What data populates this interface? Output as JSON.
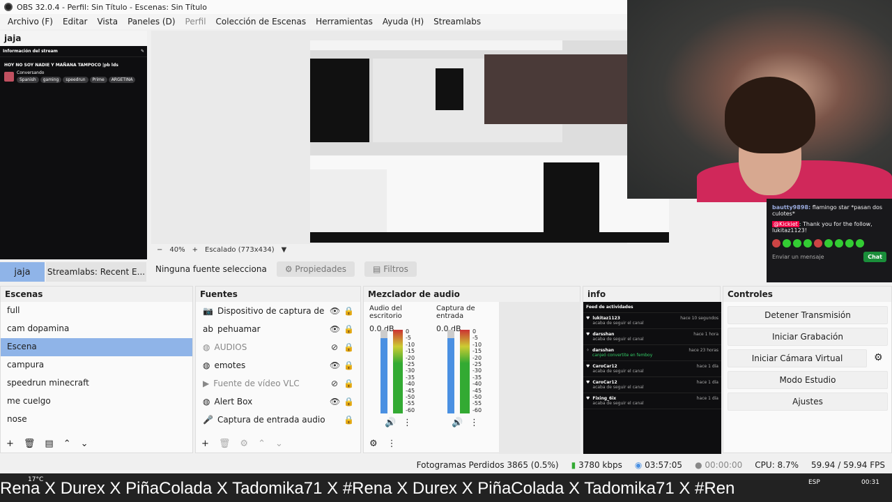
{
  "window": {
    "title": "OBS 32.0.4 - Perfil: Sin Título - Escenas: Sin Título"
  },
  "menu": [
    "Archivo (F)",
    "Editar",
    "Vista",
    "Paneles (D)",
    "Perfil",
    "Colección de Escenas",
    "Herramientas",
    "Ayuda (H)",
    "Streamlabs"
  ],
  "dock": {
    "title": "jaja",
    "stream_info": {
      "header": "Información del stream",
      "title": "HOY NO SOY NADIE Y MAÑANA TAMPOCO |pb lds",
      "category": "Conversando",
      "tags": [
        "Spanish",
        "gaming",
        "speedrun",
        "Prime",
        "ARGETINA"
      ]
    }
  },
  "preview": {
    "zoom": "40%",
    "scaling": "Escalado (773x434)"
  },
  "chat": {
    "msg1_user": "bautty9898:",
    "msg1_text": "flamingo star *pasan dos culotes*",
    "msg2_user": "@Kickiet",
    "msg2_text": ": Thank you for the follow, lukitaz1123!",
    "input": "Enviar un mensaje",
    "button": "Chat"
  },
  "tabs": {
    "jaja": "jaja",
    "recent": "Streamlabs: Recent E..."
  },
  "source_toolbar": {
    "none": "Ninguna fuente selecciona",
    "props": "Propiedades",
    "filters": "Filtros"
  },
  "scenes": {
    "title": "Escenas",
    "items": [
      "full",
      "cam dopamina",
      "Escena",
      "campura",
      "speedrun minecraft",
      "me cuelgo",
      "nose"
    ]
  },
  "sources": {
    "title": "Fuentes",
    "items": [
      "Dispositivo de captura de víd",
      "pehuamar",
      "AUDIOS",
      "emotes",
      "Fuente de vídeo VLC",
      "Alert Box",
      "Captura de entrada audio"
    ]
  },
  "mixer": {
    "title": "Mezclador de audio",
    "channels": [
      {
        "name": "Audio del escritorio",
        "db": "0.0 dB"
      },
      {
        "name": "Captura de entrada",
        "db": "0.0 dB"
      }
    ],
    "scale": [
      "0",
      "-5",
      "-10",
      "-15",
      "-20",
      "-25",
      "-30",
      "-35",
      "-40",
      "-45",
      "-50",
      "-55",
      "-60"
    ]
  },
  "info": {
    "title": "info",
    "feed_header": "Feed de actividades",
    "items": [
      {
        "user": "lukitaz1123",
        "action": "acaba de seguir el canal",
        "time": "hace 10 segundos"
      },
      {
        "user": "darsshan",
        "action": "acaba de seguir el canal",
        "time": "hace 1 hora"
      },
      {
        "user": "darsshan",
        "action": "canjeó convertite en femboy",
        "time": "hace 23 horas"
      },
      {
        "user": "CaroCar12",
        "action": "acaba de seguir el canal",
        "time": "hace 1 día"
      },
      {
        "user": "CaroCar12",
        "action": "acaba de seguir el canal",
        "time": "hace 1 día"
      },
      {
        "user": "Fixing_6ix",
        "action": "acaba de seguir el canal",
        "time": "hace 1 día"
      }
    ]
  },
  "controls": {
    "title": "Controles",
    "stop_stream": "Detener Transmisión",
    "start_rec": "Iniciar Grabación",
    "virtual_cam": "Iniciar Cámara Virtual",
    "studio": "Modo Estudio",
    "settings": "Ajustes"
  },
  "status": {
    "dropped": "Fotogramas Perdidos 3865 (0.5%)",
    "kbps": "3780 kbps",
    "live_time": "03:57:05",
    "rec_time": "00:00:00",
    "cpu": "CPU: 8.7%",
    "fps": "59.94 / 59.94 FPS"
  },
  "taskbar": {
    "ticker": "Rena  X  Durex  X  PiñaColada  X  Tadomika71  X  #Rena  X  Durex  X  PiñaColada  X  Tadomika71  X  #Ren",
    "temp": "17°C",
    "time": "00:31",
    "lang": "ESP"
  }
}
